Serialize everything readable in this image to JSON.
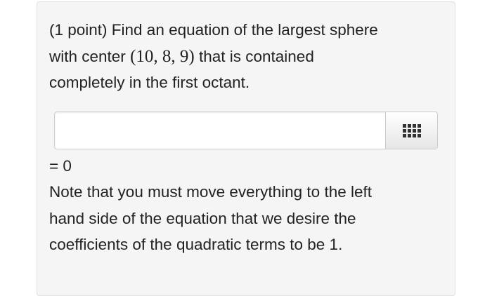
{
  "question": {
    "line1": "(1 point) Find an equation of the largest sphere",
    "line2_before": "with center ",
    "center_math": "(10, 8, 9)",
    "line2_after": " that is contained",
    "line3": "completely in the first octant."
  },
  "answer": {
    "value": "",
    "placeholder": "",
    "palette_icon": "grid-icon",
    "suffix": "= 0"
  },
  "note": {
    "line1": "Note that you must move everything to the left",
    "line2": "hand side of the equation that we desire the",
    "line3": "coefficients of the quadratic terms to be 1."
  }
}
